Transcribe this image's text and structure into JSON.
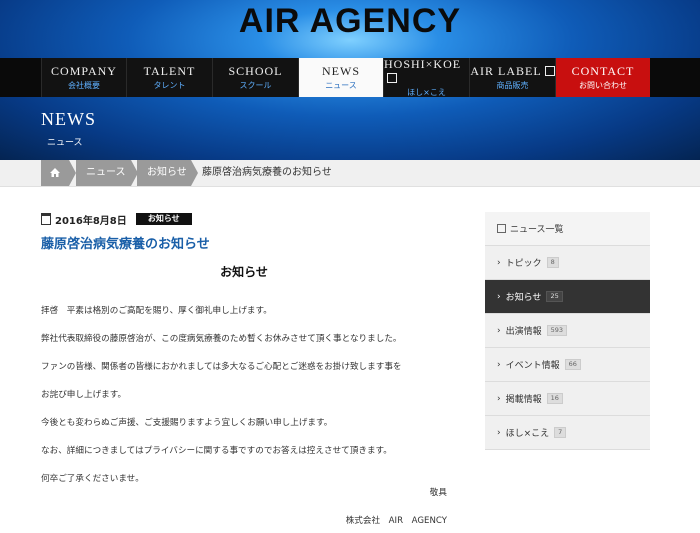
{
  "brand": "AIR AGENCY",
  "nav": [
    {
      "en": "COMPANY",
      "jp": "会社概要"
    },
    {
      "en": "TALENT",
      "jp": "タレント"
    },
    {
      "en": "SCHOOL",
      "jp": "スクール"
    },
    {
      "en": "NEWS",
      "jp": "ニュース"
    },
    {
      "en": "HOSHI×KOE",
      "jp": "ほし×こえ"
    },
    {
      "en": "AIR LABEL",
      "jp": "商品販売"
    },
    {
      "en": "CONTACT",
      "jp": "お問い合わせ"
    }
  ],
  "page": {
    "title": "NEWS",
    "subtitle": "ニュース"
  },
  "breadcrumb": {
    "home_icon": "home-icon",
    "news": "ニュース",
    "category": "お知らせ",
    "current": "藤原啓治病気療養のお知らせ"
  },
  "article": {
    "date": "2016年8月8日",
    "tag": "お知らせ",
    "title": "藤原啓治病気療養のお知らせ",
    "heading": "お知らせ",
    "paragraphs": [
      "拝啓　平素は格別のご高配を賜り、厚く御礼申し上げます。",
      "弊社代表取締役の藤原啓治が、この度病気療養のため暫くお休みさせて頂く事となりました。",
      "ファンの皆様、関係者の皆様におかれましては多大なるご心配とご迷惑をお掛け致します事を",
      "お詫び申し上げます。",
      "今後とも変わらぬご声援、ご支援賜りますよう宜しくお願い申し上げます。",
      "なお、詳細につきましてはプライバシーに関する事ですのでお答えは控えさせて頂きます。",
      "何卒ご了承くださいませ。"
    ],
    "closing": "敬具",
    "signature": "株式会社　AIR　AGENCY"
  },
  "sidebar": {
    "header": "ニュース一覧",
    "items": [
      {
        "label": "トピック",
        "count": "8"
      },
      {
        "label": "お知らせ",
        "count": "25"
      },
      {
        "label": "出演情報",
        "count": "593"
      },
      {
        "label": "イベント情報",
        "count": "66"
      },
      {
        "label": "掲載情報",
        "count": "16"
      },
      {
        "label": "ほし×こえ",
        "count": "7"
      }
    ]
  }
}
